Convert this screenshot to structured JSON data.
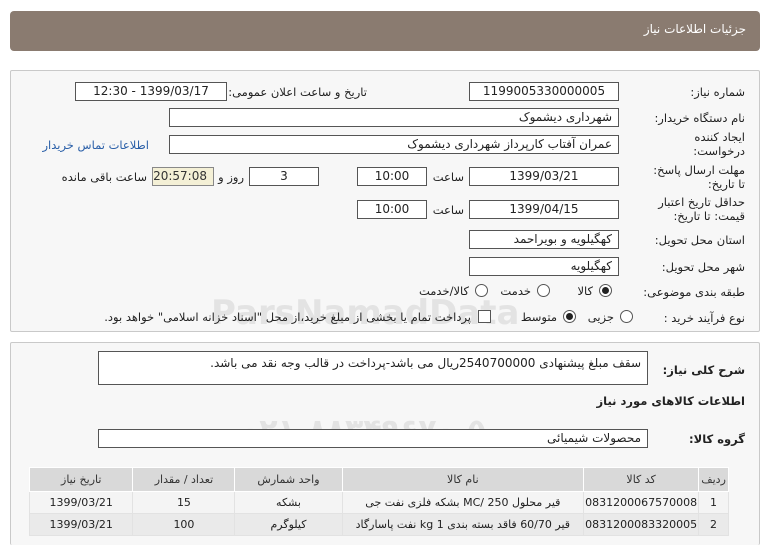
{
  "page_title": "جزئیات اطلاعات نیاز",
  "form": {
    "need_number_label": "شماره نیاز:",
    "need_number": "1199005330000005",
    "announce_label": "تاریخ و ساعت اعلان عمومی:",
    "announce_value": "1399/03/17 - 12:30",
    "buyer_org_label": "نام دستگاه خریدار:",
    "buyer_org": "شهرداری دیشموک",
    "requester_label_1": "ایجاد کننده",
    "requester_label_2": "درخواست:",
    "requester": "عمران آفتاب کارپرداز شهرداری دیشموک",
    "contact_link": "اطلاعات تماس خریدار",
    "deadline_label_1": "مهلت ارسال پاسخ:",
    "deadline_label_2": "تا تاریخ:",
    "deadline_date": "1399/03/21",
    "time_label": "ساعت",
    "deadline_time": "10:00",
    "days_value": "3",
    "days_label": "روز و",
    "remaining_time": "20:57:08",
    "remaining_label": "ساعت باقی مانده",
    "validity_label_1": "حداقل تاریخ اعتبار",
    "validity_label_2": "قیمت: تا تاریخ:",
    "validity_date": "1399/04/15",
    "validity_time_label": "ساعت",
    "validity_time": "10:00",
    "province_label": "استان محل تحویل:",
    "province": "کهگیلویه و بویراحمد",
    "city_label": "شهر محل تحویل:",
    "city": "کهگیلویه",
    "category_label": "طبقه بندی موضوعی:",
    "category_options": [
      "کالا",
      "خدمت",
      "کالا/خدمت"
    ],
    "purchase_type_label": "نوع فرآیند خرید :",
    "purchase_options": [
      "جزیی",
      "متوسط"
    ],
    "payment_note": "پرداخت تمام یا بخشی از مبلغ خرید،از محل \"اسناد خزانه اسلامی\" خواهد بود."
  },
  "description": {
    "label": "شرح کلی نیاز:",
    "text": "سقف مبلغ پیشنهادی 2540700000ریال می باشد-پرداخت در قالب وجه نقد می باشد."
  },
  "goods_section_title": "اطلاعات کالاهای مورد نیاز",
  "goods_group": {
    "label": "گروه کالا:",
    "value": "محصولات شیمیائی"
  },
  "table": {
    "headers": [
      "ردیف",
      "کد کالا",
      "نام کالا",
      "واحد شمارش",
      "تعداد / مقدار",
      "تاریخ نیاز"
    ],
    "rows": [
      [
        "1",
        "0831200067570008",
        "قیر محلول MC/ 250 بشکه فلزی نفت جی",
        "بشکه",
        "15",
        "1399/03/21"
      ],
      [
        "2",
        "0831200083320005",
        "قیر 60/70 فاقد بسته بندی 1 kg نفت پاسارگاد",
        "کیلوگرم",
        "100",
        "1399/03/21"
      ]
    ]
  },
  "watermark": {
    "text_1": "ParsNamadData",
    "text_2": "پایگاه اطلاع رسانی مناقصه و مزایده",
    "text_3": "۰۲۱-۸۸۳۴۹۶۷۰-۵"
  },
  "colors": {
    "title_bar": "#8a7b70",
    "highlight_time": "#f4f0d6",
    "link": "#2a5fa8"
  }
}
